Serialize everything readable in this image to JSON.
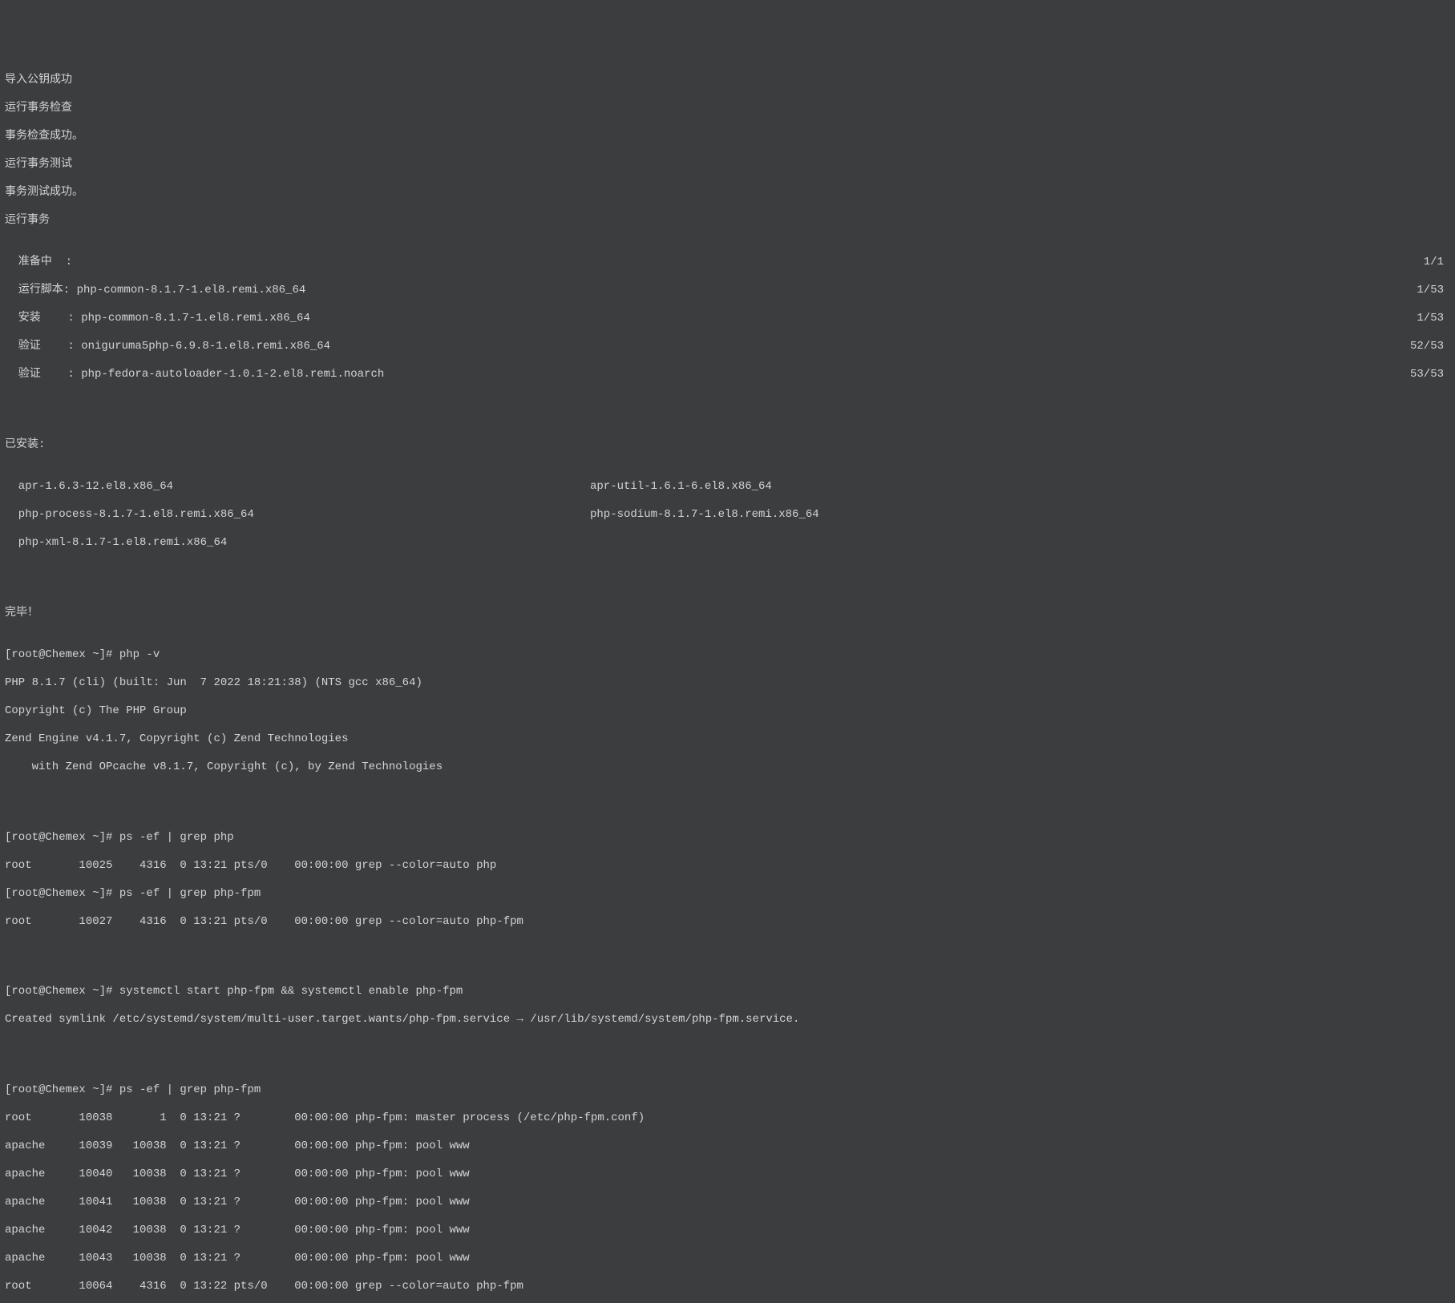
{
  "intro_lines": [
    "导入公钥成功",
    "运行事务检查",
    "事务检查成功。",
    "运行事务测试",
    "事务测试成功。",
    "运行事务"
  ],
  "progress_lines": [
    {
      "left": "  准备中  :",
      "right": "1/1"
    },
    {
      "left": "  运行脚本: php-common-8.1.7-1.el8.remi.x86_64",
      "right": "1/53"
    },
    {
      "left": "  安装    : php-common-8.1.7-1.el8.remi.x86_64",
      "right": "1/53"
    },
    {
      "left": "  验证    : oniguruma5php-6.9.8-1.el8.remi.x86_64",
      "right": "52/53"
    },
    {
      "left": "  验证    : php-fedora-autoloader-1.0.1-2.el8.remi.noarch",
      "right": "53/53"
    }
  ],
  "installed_header": "已安装:",
  "installed_cols": [
    {
      "left": "  apr-1.6.3-12.el8.x86_64",
      "right": "apr-util-1.6.1-6.el8.x86_64"
    },
    {
      "left": "  php-process-8.1.7-1.el8.remi.x86_64",
      "right": "php-sodium-8.1.7-1.el8.remi.x86_64"
    },
    {
      "left": "  php-xml-8.1.7-1.el8.remi.x86_64",
      "right": ""
    }
  ],
  "done": "完毕！",
  "php_version_block": [
    "[root@Chemex ~]# php -v",
    "PHP 8.1.7 (cli) (built: Jun  7 2022 18:21:38) (NTS gcc x86_64)",
    "Copyright (c) The PHP Group",
    "Zend Engine v4.1.7, Copyright (c) Zend Technologies",
    "    with Zend OPcache v8.1.7, Copyright (c), by Zend Technologies"
  ],
  "ps_block1": [
    "[root@Chemex ~]# ps -ef | grep php",
    "root       10025    4316  0 13:21 pts/0    00:00:00 grep --color=auto php",
    "[root@Chemex ~]# ps -ef | grep php-fpm",
    "root       10027    4316  0 13:21 pts/0    00:00:00 grep --color=auto php-fpm"
  ],
  "systemctl_block": [
    "[root@Chemex ~]# systemctl start php-fpm && systemctl enable php-fpm",
    "Created symlink /etc/systemd/system/multi-user.target.wants/php-fpm.service → /usr/lib/systemd/system/php-fpm.service."
  ],
  "ps_block2": [
    "[root@Chemex ~]# ps -ef | grep php-fpm",
    "root       10038       1  0 13:21 ?        00:00:00 php-fpm: master process (/etc/php-fpm.conf)",
    "apache     10039   10038  0 13:21 ?        00:00:00 php-fpm: pool www",
    "apache     10040   10038  0 13:21 ?        00:00:00 php-fpm: pool www",
    "apache     10041   10038  0 13:21 ?        00:00:00 php-fpm: pool www",
    "apache     10042   10038  0 13:21 ?        00:00:00 php-fpm: pool www",
    "apache     10043   10038  0 13:21 ?        00:00:00 php-fpm: pool www",
    "root       10064    4316  0 13:22 pts/0    00:00:00 grep --color=auto php-fpm"
  ]
}
